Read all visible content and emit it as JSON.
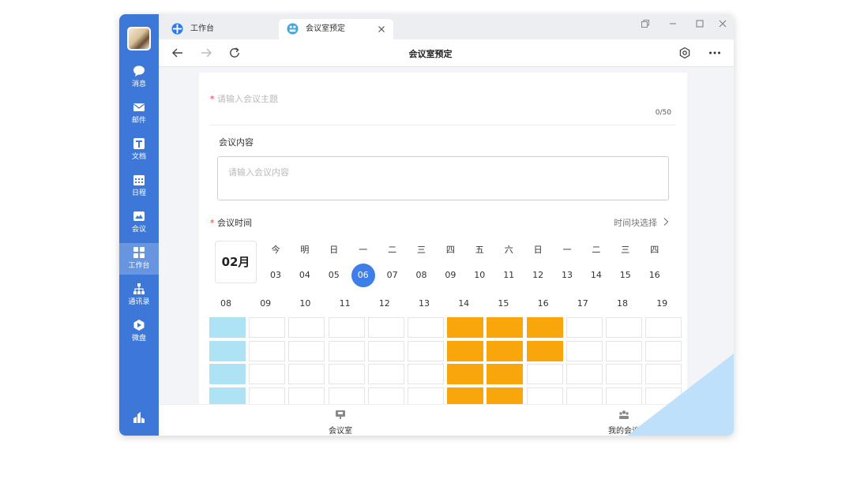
{
  "colors": {
    "accent": "#3d78d8",
    "booked": "#f8a60b",
    "mine": "#aee2f5",
    "selected_date": "#3d7ee9"
  },
  "sidebar": {
    "items": [
      {
        "label": "消息",
        "icon": "message-icon"
      },
      {
        "label": "邮件",
        "icon": "mail-icon"
      },
      {
        "label": "文档",
        "icon": "document-icon"
      },
      {
        "label": "日程",
        "icon": "calendar-icon"
      },
      {
        "label": "会议",
        "icon": "meeting-icon"
      },
      {
        "label": "工作台",
        "icon": "workbench-icon",
        "active": true
      },
      {
        "label": "通讯录",
        "icon": "contacts-icon"
      },
      {
        "label": "微盘",
        "icon": "drive-icon"
      }
    ]
  },
  "tabs": [
    {
      "label": "工作台",
      "icon": "workbench-tab-icon"
    },
    {
      "label": "会议室预定",
      "icon": "meeting-room-tab-icon",
      "active": true
    }
  ],
  "toolbar": {
    "title": "会议室预定"
  },
  "form": {
    "required_mark": "*",
    "subject_placeholder": "请输入会议主题",
    "subject_count": "0/50",
    "content_label": "会议内容",
    "content_placeholder": "请输入会议内容",
    "time_label": "会议时间",
    "time_block_link": "时间块选择"
  },
  "calendar": {
    "month": "02月",
    "weekdays": [
      "今",
      "明",
      "日",
      "一",
      "二",
      "三",
      "四",
      "五",
      "六",
      "日",
      "一",
      "二",
      "三",
      "四"
    ],
    "dates": [
      "03",
      "04",
      "05",
      "06",
      "07",
      "08",
      "09",
      "10",
      "11",
      "12",
      "13",
      "14",
      "15",
      "16"
    ],
    "selected_date": "06",
    "hours": [
      "08",
      "09",
      "10",
      "11",
      "12",
      "13",
      "14",
      "15",
      "16",
      "17",
      "18",
      "19"
    ],
    "slots": [
      [
        "mine",
        "free",
        "free",
        "free",
        "free",
        "free",
        "booked",
        "booked",
        "booked",
        "free",
        "free",
        "free"
      ],
      [
        "mine",
        "free",
        "free",
        "free",
        "free",
        "free",
        "booked",
        "booked",
        "booked",
        "free",
        "free",
        "free"
      ],
      [
        "mine",
        "free",
        "free",
        "free",
        "free",
        "free",
        "booked",
        "booked",
        "free",
        "free",
        "free",
        "free"
      ],
      [
        "mine",
        "free",
        "free",
        "free",
        "free",
        "free",
        "booked",
        "booked",
        "free",
        "free",
        "free",
        "free"
      ]
    ]
  },
  "bottom_nav": {
    "items": [
      {
        "label": "会议室",
        "icon": "meeting-room-icon"
      },
      {
        "label": "我的会议",
        "icon": "my-meetings-icon"
      }
    ]
  }
}
